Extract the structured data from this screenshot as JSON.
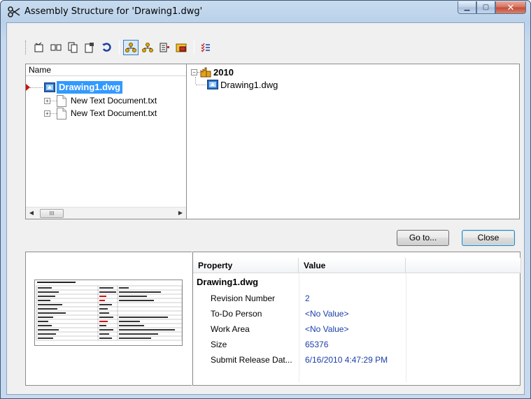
{
  "window": {
    "title": "Assembly Structure for 'Drawing1.dwg'",
    "icon": "scissors-icon"
  },
  "toolbar": {
    "buttons": [
      {
        "name": "new-icon",
        "pressed": false
      },
      {
        "name": "book-icon",
        "pressed": false
      },
      {
        "name": "copy-document-icon",
        "pressed": false
      },
      {
        "name": "properties-icon",
        "pressed": false
      },
      {
        "name": "refresh-icon",
        "pressed": false
      },
      {
        "name": "structure-tree-icon",
        "pressed": true
      },
      {
        "name": "structure-alt-icon",
        "pressed": false
      },
      {
        "name": "list-tree-icon",
        "pressed": false
      },
      {
        "name": "folder-image-icon",
        "pressed": false
      },
      {
        "name": "checklist-icon",
        "pressed": false
      }
    ]
  },
  "left_tree": {
    "header": "Name",
    "root": "Drawing1.dwg",
    "children": [
      "New Text Document.txt",
      "New Text Document.txt"
    ],
    "scroll_thumb": "III"
  },
  "right_tree": {
    "root": "2010",
    "child": "Drawing1.dwg"
  },
  "buttons": {
    "goto": "Go to...",
    "close": "Close"
  },
  "properties": {
    "columns": [
      "Property",
      "Value"
    ],
    "group": "Drawing1.dwg",
    "rows": [
      {
        "property": "Revision Number",
        "value": "2"
      },
      {
        "property": "To-Do Person",
        "value": "<No Value>"
      },
      {
        "property": "Work Area",
        "value": "<No Value>"
      },
      {
        "property": "Size",
        "value": "65376"
      },
      {
        "property": "Submit Release Dat...",
        "value": "6/16/2010 4:47:29 PM"
      }
    ]
  },
  "colors": {
    "selection": "#3399ff",
    "value_text": "#1a3ea8"
  }
}
